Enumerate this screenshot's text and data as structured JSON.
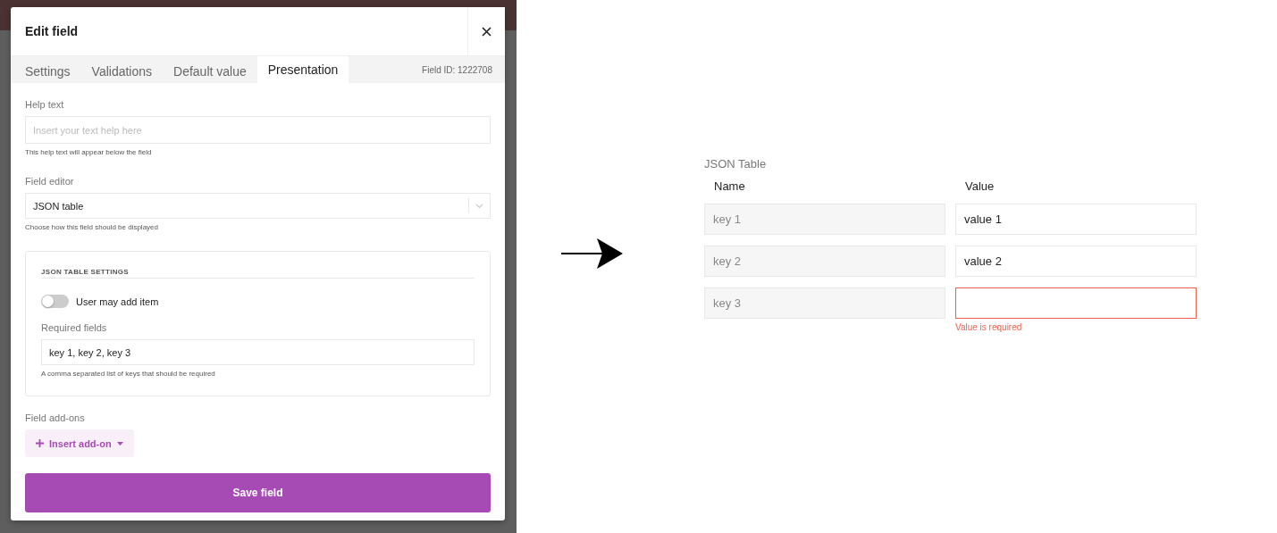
{
  "modal": {
    "title": "Edit field",
    "tabs": [
      {
        "label": "Settings",
        "selected": false
      },
      {
        "label": "Validations",
        "selected": false
      },
      {
        "label": "Default value",
        "selected": false
      },
      {
        "label": "Presentation",
        "selected": true
      }
    ],
    "field_id": "Field ID: 1222708",
    "help_text": {
      "label": "Help text",
      "placeholder": "Insert your text help here",
      "hint": "This help text will appear below the field"
    },
    "field_editor": {
      "label": "Field editor",
      "value": "JSON table",
      "hint": "Choose how this field should be displayed"
    },
    "settings": {
      "heading": "JSON TABLE SETTINGS",
      "toggle": {
        "label": "User may add item",
        "on": false
      },
      "required_fields": {
        "label": "Required fields",
        "value": "key 1, key 2, key 3",
        "hint": "A comma separated list of keys that should be required"
      }
    },
    "addons": {
      "label": "Field add-ons",
      "button": "Insert add-on"
    },
    "save_button": "Save field"
  },
  "preview": {
    "title": "JSON Table",
    "columns": [
      "Name",
      "Value"
    ],
    "rows": [
      {
        "name": "key 1",
        "value": "value 1",
        "invalid": false
      },
      {
        "name": "key 2",
        "value": "value 2",
        "invalid": false
      },
      {
        "name": "key 3",
        "invalid": true,
        "message": "Value is required"
      }
    ]
  }
}
